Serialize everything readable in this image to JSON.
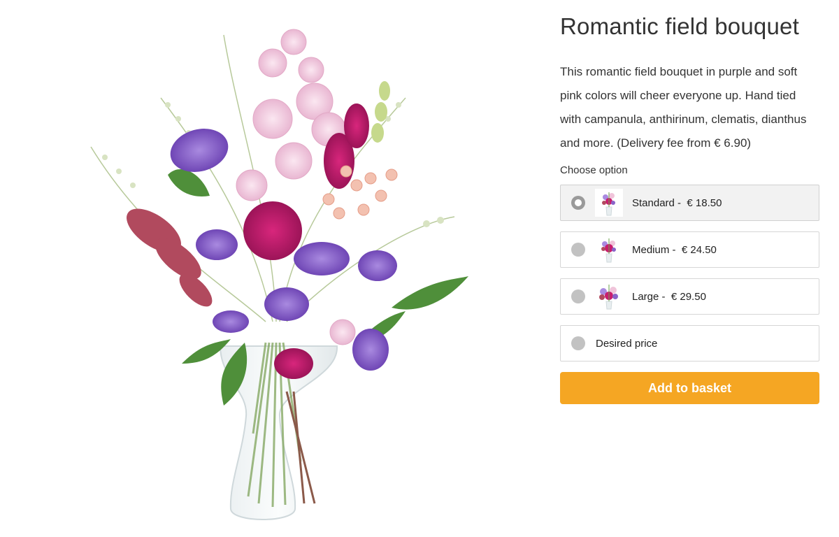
{
  "product": {
    "title": "Romantic field bouquet",
    "description": "This romantic field bouquet in purple and soft pink colors will cheer everyone up. Hand tied with campanula, anthirinum, clematis, dianthus and more. (Delivery fee from € 6.90)",
    "image_icon": "bouquet-in-vase-photo"
  },
  "options": {
    "label": "Choose option",
    "items": [
      {
        "label": "Standard -  € 18.50",
        "selected": true
      },
      {
        "label": "Medium -  € 24.50",
        "selected": false
      },
      {
        "label": "Large -  € 29.50",
        "selected": false
      },
      {
        "label": "Desired price",
        "selected": false
      }
    ]
  },
  "cta": {
    "label": "Add to basket",
    "color": "#f5a623"
  }
}
